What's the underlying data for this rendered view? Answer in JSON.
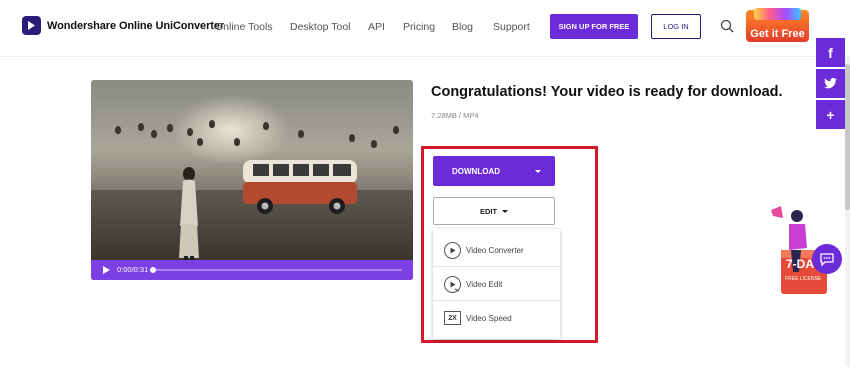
{
  "header": {
    "brand": "Wondershare Online UniConverter",
    "nav": [
      "Online Tools",
      "Desktop Tool",
      "API",
      "Pricing",
      "Blog",
      "Support"
    ],
    "signup_label": "SIGN UP FOR FREE",
    "login_label": "LOG IN",
    "promo_label": "Get it Free"
  },
  "social": [
    "f",
    "twitter-icon",
    "+"
  ],
  "video": {
    "time": "0:00/0:31",
    "progress": 0.0
  },
  "result": {
    "title": "Congratulations! Your video is ready for download.",
    "meta": "7.28MB / MP4",
    "download_label": "DOWNLOAD",
    "edit_label": "EDIT",
    "menu": [
      "Video Converter",
      "Video Edit",
      "Video Speed"
    ],
    "speed_icon_text": "2X"
  },
  "side_promo": {
    "badge": "7-DA",
    "sub": "FREE LICENSE"
  },
  "colors": {
    "accent": "#6c2bd9",
    "highlight": "#d01c2a"
  }
}
